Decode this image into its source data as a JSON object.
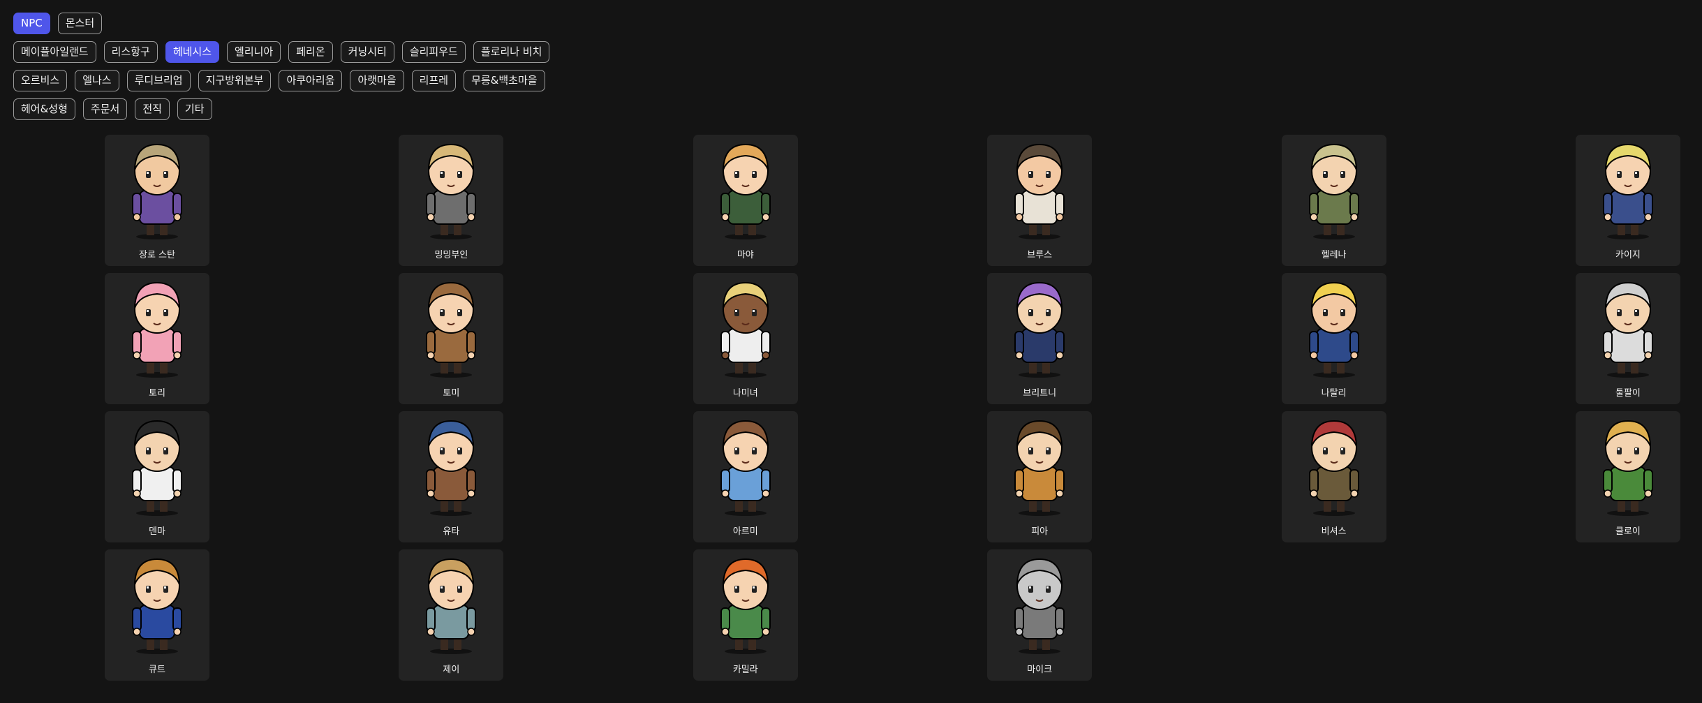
{
  "filters": {
    "type_row": [
      {
        "label": "NPC",
        "active": true
      },
      {
        "label": "몬스터",
        "active": false
      }
    ],
    "region_rows": [
      [
        {
          "label": "메이플아일랜드",
          "active": false
        },
        {
          "label": "리스항구",
          "active": false
        },
        {
          "label": "헤네시스",
          "active": true
        },
        {
          "label": "엘리니아",
          "active": false
        },
        {
          "label": "페리온",
          "active": false
        },
        {
          "label": "커닝시티",
          "active": false
        },
        {
          "label": "슬리피우드",
          "active": false
        },
        {
          "label": "플로리나 비치",
          "active": false
        }
      ],
      [
        {
          "label": "오르비스",
          "active": false
        },
        {
          "label": "엘나스",
          "active": false
        },
        {
          "label": "루디브리엄",
          "active": false
        },
        {
          "label": "지구방위본부",
          "active": false
        },
        {
          "label": "아쿠아리움",
          "active": false
        },
        {
          "label": "아랫마을",
          "active": false
        },
        {
          "label": "리프레",
          "active": false
        },
        {
          "label": "무릉&백초마을",
          "active": false
        }
      ],
      [
        {
          "label": "헤어&성형",
          "active": false
        },
        {
          "label": "주문서",
          "active": false
        },
        {
          "label": "전직",
          "active": false
        },
        {
          "label": "기타",
          "active": false
        }
      ]
    ]
  },
  "colors": {
    "accent": "#4f56ea",
    "background": "#141414",
    "card": "#232323",
    "chip_border": "#9a9a9a"
  },
  "npcs": [
    {
      "name": "장로 스탄",
      "hair": "#b8a57a",
      "outfit": "#6b4fa0",
      "skin": "#f1c9a0"
    },
    {
      "name": "밍밍부인",
      "hair": "#d8b878",
      "outfit": "#6e6e6e",
      "skin": "#f6d3b1"
    },
    {
      "name": "마야",
      "hair": "#e3a85a",
      "outfit": "#3c5e3a",
      "skin": "#f6d3b1"
    },
    {
      "name": "브루스",
      "hair": "#5a4a3a",
      "outfit": "#e8e2d6",
      "skin": "#f3c9a3"
    },
    {
      "name": "헬레나",
      "hair": "#c9c28e",
      "outfit": "#6b7a4c",
      "skin": "#f3d3b0"
    },
    {
      "name": "카이지",
      "hair": "#e6d86c",
      "outfit": "#3a4f8c",
      "skin": "#f6d3b1"
    },
    {
      "name": "토리",
      "hair": "#f2a2b6",
      "outfit": "#f2a2b6",
      "skin": "#f6d3b1"
    },
    {
      "name": "토미",
      "hair": "#9a6a3e",
      "outfit": "#9a6a3e",
      "skin": "#f6d3b1"
    },
    {
      "name": "나미녀",
      "hair": "#e8d07a",
      "outfit": "#eeeeee",
      "skin": "#8a5a3a"
    },
    {
      "name": "브리트니",
      "hair": "#9a6acb",
      "outfit": "#2a3a6a",
      "skin": "#f3d3b0"
    },
    {
      "name": "나탈리",
      "hair": "#f0d050",
      "outfit": "#2e4a8a",
      "skin": "#f3c9a3"
    },
    {
      "name": "둘팔이",
      "hair": "#cfcfcf",
      "outfit": "#dcdcdc",
      "skin": "#f3d3b0"
    },
    {
      "name": "덴마",
      "hair": "#2a2a2a",
      "outfit": "#f0f0f0",
      "skin": "#f3d3b0"
    },
    {
      "name": "유타",
      "hair": "#3a5e9a",
      "outfit": "#8a5a3a",
      "skin": "#f6d3b1"
    },
    {
      "name": "아르미",
      "hair": "#8a5a3a",
      "outfit": "#6aa0d8",
      "skin": "#f6d3b1"
    },
    {
      "name": "피아",
      "hair": "#6a4a2a",
      "outfit": "#c98a3a",
      "skin": "#f3d3b0"
    },
    {
      "name": "비셔스",
      "hair": "#b03a3a",
      "outfit": "#6a5a3a",
      "skin": "#f3d3b0"
    },
    {
      "name": "클로이",
      "hair": "#e0b050",
      "outfit": "#4a8a3a",
      "skin": "#f3d3b0"
    },
    {
      "name": "큐트",
      "hair": "#c98a3a",
      "outfit": "#2a4aa0",
      "skin": "#f6d3b1"
    },
    {
      "name": "제이",
      "hair": "#c9a060",
      "outfit": "#7a9aa0",
      "skin": "#f6d3b1"
    },
    {
      "name": "카밀라",
      "hair": "#e06a2a",
      "outfit": "#4a8a4a",
      "skin": "#f6d3b1"
    },
    {
      "name": "마이크",
      "hair": "#9a9a9a",
      "outfit": "#7a7a7a",
      "skin": "#c9c9c9"
    }
  ]
}
